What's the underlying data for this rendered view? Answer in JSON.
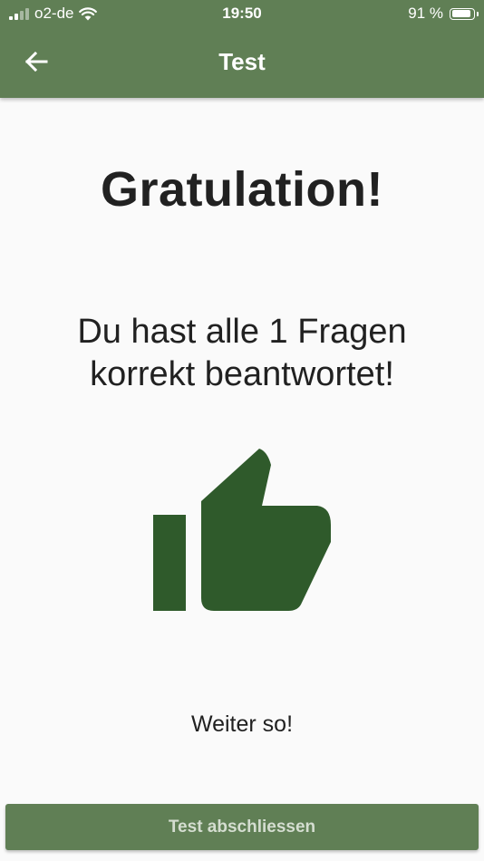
{
  "status_bar": {
    "carrier": "o2-de",
    "time": "19:50",
    "battery_percent": "91 %",
    "battery_level": 0.91,
    "icons": [
      "signal-icon",
      "wifi-icon",
      "battery-icon"
    ]
  },
  "app_bar": {
    "title": "Test",
    "back_icon": "arrow-left-icon"
  },
  "content": {
    "heading": "Gratulation!",
    "message": "Du hast alle 1 Fragen korrekt beantwortet!",
    "icon": "thumbs-up-icon",
    "subtext": "Weiter so!"
  },
  "footer": {
    "finish_label": "Test abschliessen"
  },
  "colors": {
    "primary": "#607f55",
    "thumb": "#2f5a2b",
    "background": "#fafafa",
    "text": "#212121",
    "button_text": "#d4ddd0"
  }
}
